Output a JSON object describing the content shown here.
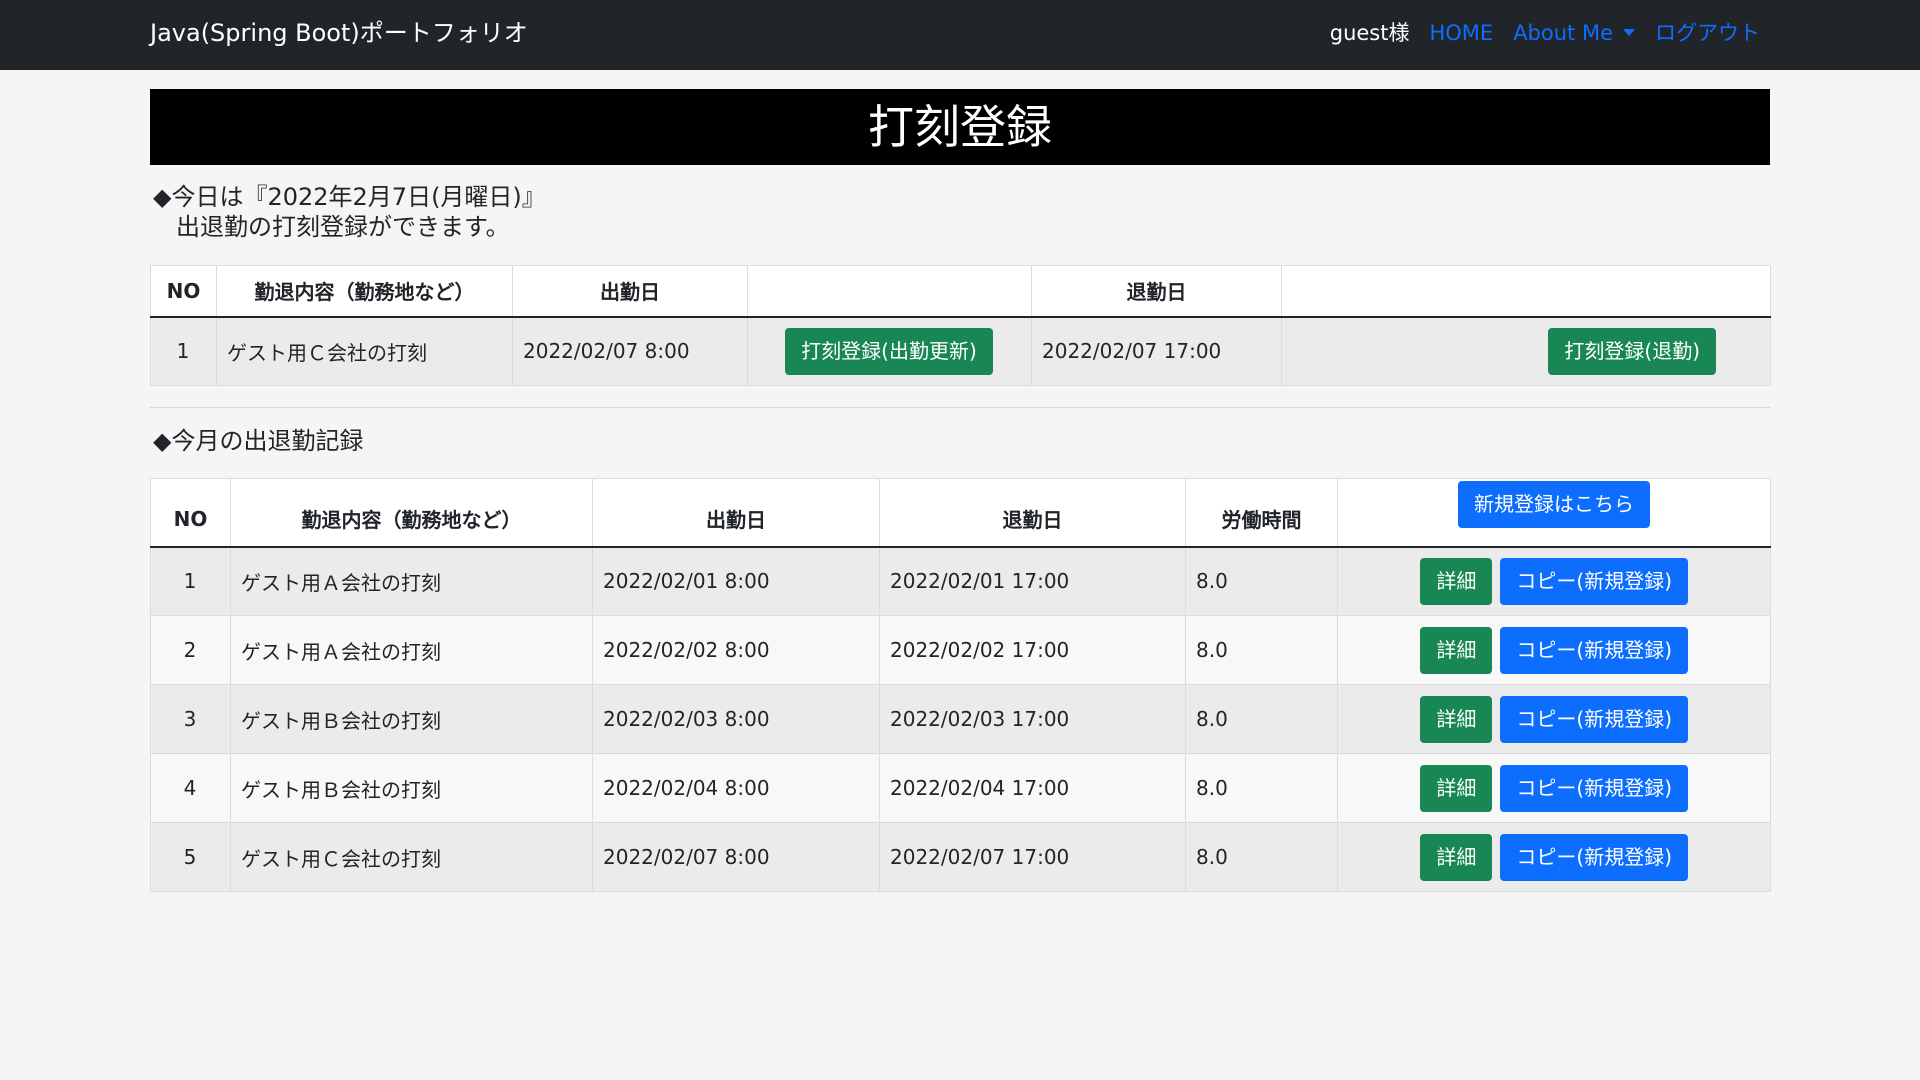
{
  "navbar": {
    "brand": "Java(Spring Boot)ポートフォリオ",
    "user": "guest様",
    "home": "HOME",
    "about": "About Me",
    "logout": "ログアウト"
  },
  "page": {
    "title": "打刻登録"
  },
  "today": {
    "line1": "◆今日は『2022年2月7日(月曜日)』",
    "line2": "出退勤の打刻登録ができます。"
  },
  "punch_table": {
    "headers": [
      "NO",
      "勤退内容（勤務地など）",
      "出勤日",
      "",
      "退勤日",
      ""
    ],
    "row": {
      "no": "1",
      "content": "ゲスト用Ｃ会社の打刻",
      "start": "2022/02/07 8:00",
      "start_button": "打刻登録(出勤更新)",
      "end": "2022/02/07 17:00",
      "end_button": "打刻登録(退勤)"
    }
  },
  "month": {
    "heading": "◆今月の出退勤記録",
    "headers": [
      "NO",
      "勤退内容（勤務地など）",
      "出勤日",
      "退勤日",
      "労働時間"
    ],
    "new_button": "新規登録はこちら",
    "detail_label": "詳細",
    "copy_label": "コピー(新規登録)",
    "rows": [
      {
        "no": "1",
        "content": "ゲスト用Ａ会社の打刻",
        "start": "2022/02/01 8:00",
        "end": "2022/02/01 17:00",
        "hours": "8.0"
      },
      {
        "no": "2",
        "content": "ゲスト用Ａ会社の打刻",
        "start": "2022/02/02 8:00",
        "end": "2022/02/02 17:00",
        "hours": "8.0"
      },
      {
        "no": "3",
        "content": "ゲスト用Ｂ会社の打刻",
        "start": "2022/02/03 8:00",
        "end": "2022/02/03 17:00",
        "hours": "8.0"
      },
      {
        "no": "4",
        "content": "ゲスト用Ｂ会社の打刻",
        "start": "2022/02/04 8:00",
        "end": "2022/02/04 17:00",
        "hours": "8.0"
      },
      {
        "no": "5",
        "content": "ゲスト用Ｃ会社の打刻",
        "start": "2022/02/07 8:00",
        "end": "2022/02/07 17:00",
        "hours": "8.0"
      }
    ]
  }
}
